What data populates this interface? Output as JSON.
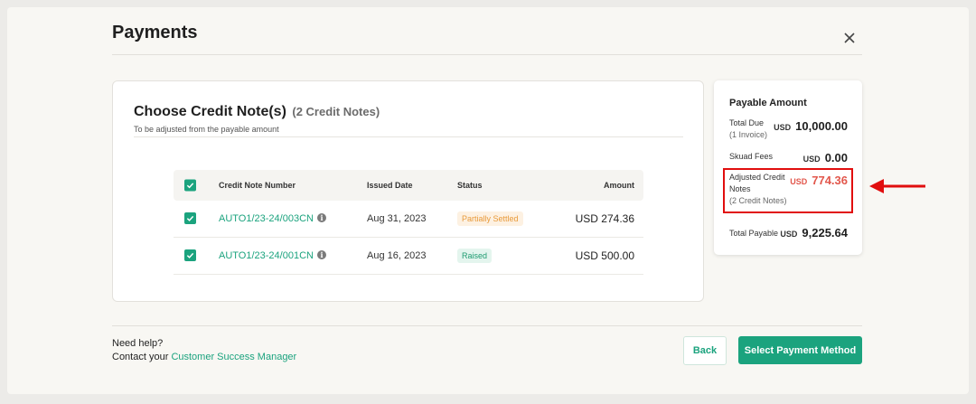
{
  "modal": {
    "title": "Payments"
  },
  "credit_notes": {
    "title": "Choose Credit Note(s)",
    "count_label": "(2 Credit Notes)",
    "subtitle": "To be adjusted from the payable amount",
    "columns": {
      "number": "Credit Note Number",
      "date": "Issued Date",
      "status": "Status",
      "amount": "Amount"
    },
    "rows": [
      {
        "number": "AUTO1/23-24/003CN",
        "date": "Aug 31, 2023",
        "status": "Partially Settled",
        "amount": "USD 274.36",
        "checked": true
      },
      {
        "number": "AUTO1/23-24/001CN",
        "date": "Aug 16, 2023",
        "status": "Raised",
        "amount": "USD 500.00",
        "checked": true
      }
    ]
  },
  "summary": {
    "title": "Payable Amount",
    "total_due_label": "Total Due",
    "total_due_sub": "(1 Invoice)",
    "total_due_currency": "USD",
    "total_due_value": "10,000.00",
    "fees_label": "Skuad Fees",
    "fees_currency": "USD",
    "fees_value": "0.00",
    "adjusted_label_1": "Adjusted Credit",
    "adjusted_label_2": "Notes",
    "adjusted_sub": "(2 Credit Notes)",
    "adjusted_currency": "USD",
    "adjusted_value": "774.36",
    "payable_label": "Total Payable",
    "payable_currency": "USD",
    "payable_value": "9,225.64"
  },
  "footer": {
    "help_line": "Need help?",
    "contact_prefix": "Contact your",
    "contact_link": "Customer Success Manager",
    "back_label": "Back",
    "primary_label": "Select Payment Method"
  },
  "colors": {
    "accent": "#1ba37e",
    "negative": "#e2574c",
    "highlight": "#e10e0e"
  },
  "icons": {
    "close": "close-icon",
    "info": "info-icon",
    "check": "check-icon",
    "arrow": "arrow-left-icon"
  }
}
